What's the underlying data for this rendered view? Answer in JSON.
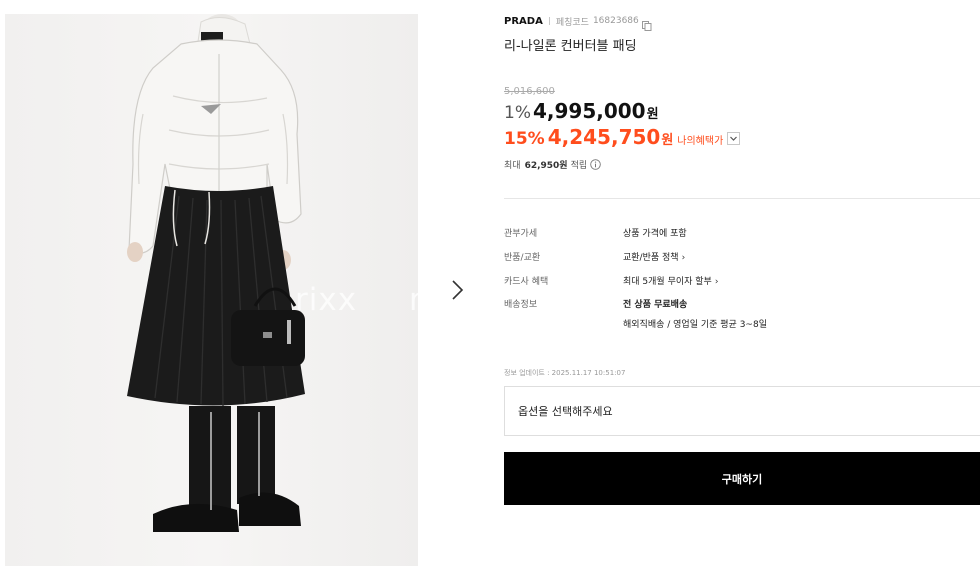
{
  "product": {
    "brand": "PRADA",
    "code_label": "페칭코드",
    "code_value": "16823686",
    "title": "리-나일론 컨버터블 패딩",
    "watermark": "rixx",
    "watermark_partial": "r"
  },
  "pricing": {
    "original_price": "5,016,600",
    "discount1_rate": "1%",
    "discount1_price": "4,995,000",
    "currency": "원",
    "discount2_rate": "15%",
    "discount2_price": "4,245,750",
    "benefit_label": "나의혜택가",
    "points_label": "최대",
    "points_value": "62,950원",
    "points_suffix": "적립"
  },
  "specs": {
    "duty_label": "관부가세",
    "duty_value": "상품 가격에 포함",
    "return_label": "반품/교환",
    "return_value": "교환/반품 정책",
    "card_label": "카드사 혜택",
    "card_value": "최대 5개월 무이자 할부",
    "shipping_label": "배송정보",
    "shipping_value1": "전 상품 무료배송",
    "shipping_value2": "해외직배송 / 영업일 기준 평균 3~8일"
  },
  "update_text": "정보 업데이트 : 2025.11.17 10:51:07",
  "option_placeholder": "옵션을 선택해주세요",
  "buy_label": "구매하기",
  "icons": {
    "next": "chevron-right-icon",
    "copy": "copy-icon",
    "dropdown": "chevron-down-icon",
    "info": "info-icon"
  },
  "colors": {
    "accent": "#ff4d1d",
    "button_bg": "#000000",
    "muted": "#999999"
  }
}
